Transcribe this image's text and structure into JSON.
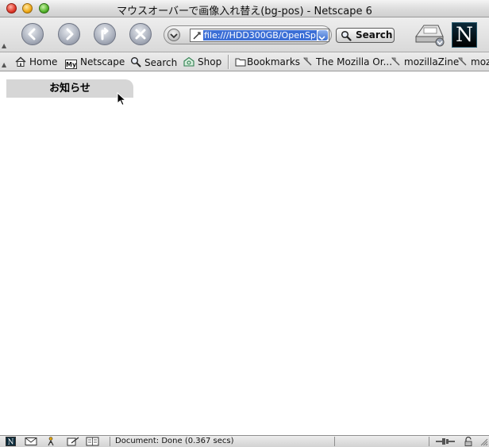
{
  "window": {
    "title": "マウスオーバーで画像入れ替え(bg-pos) - Netscape 6"
  },
  "navigation": {
    "url": "file:///HDD300GB/OpenSp",
    "search_label": "Search",
    "logo_letter": "N"
  },
  "personal_toolbar": {
    "items": [
      {
        "label": "Home",
        "icon": "home-icon"
      },
      {
        "label": "Netscape",
        "icon": "my-netscape-icon"
      },
      {
        "label": "Search",
        "icon": "search-icon"
      },
      {
        "label": "Shop",
        "icon": "shop-icon"
      },
      {
        "label": "Bookmarks",
        "icon": "folder-icon"
      },
      {
        "label": "The Mozilla Or...",
        "icon": "bookmark-icon"
      },
      {
        "label": "mozillaZine",
        "icon": "bookmark-icon"
      },
      {
        "label": "moz",
        "icon": "bookmark-icon"
      }
    ],
    "my_badge": "My"
  },
  "content": {
    "notice_heading": "お知らせ"
  },
  "status": {
    "text": "Document: Done (0.367 secs)"
  }
}
